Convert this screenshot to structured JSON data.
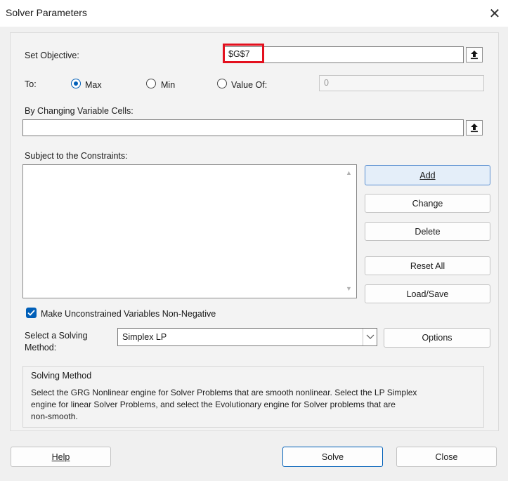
{
  "window": {
    "title": "Solver Parameters"
  },
  "objective": {
    "label": "Set Objective:",
    "value": "$G$7"
  },
  "to": {
    "label": "To:",
    "options": [
      {
        "label": "Max",
        "selected": true
      },
      {
        "label": "Min",
        "selected": false
      },
      {
        "label": "Value Of:",
        "selected": false
      }
    ],
    "value_of": "0"
  },
  "changing_cells": {
    "label": "By Changing Variable Cells:",
    "value": ""
  },
  "constraints": {
    "label": "Subject to the Constraints:",
    "items": []
  },
  "constraint_buttons": {
    "add": "Add",
    "change": "Change",
    "delete": "Delete",
    "reset_all": "Reset All",
    "load_save": "Load/Save"
  },
  "non_negative": {
    "label": "Make Unconstrained Variables Non-Negative",
    "checked": true
  },
  "solving_method": {
    "label_line1": "Select a Solving",
    "label_line2": "Method:",
    "value": "Simplex LP",
    "options_button": "Options"
  },
  "method_group": {
    "title": "Solving Method",
    "line1": "Select the GRG Nonlinear engine for Solver Problems that are smooth nonlinear. Select the LP Simplex",
    "line2": "engine for linear Solver Problems, and select the Evolutionary engine for Solver problems that are",
    "line3": "non-smooth."
  },
  "footer": {
    "help": "Help",
    "solve": "Solve",
    "close": "Close"
  },
  "colors": {
    "accent": "#005fb8",
    "highlight_box": "#e3101e"
  }
}
